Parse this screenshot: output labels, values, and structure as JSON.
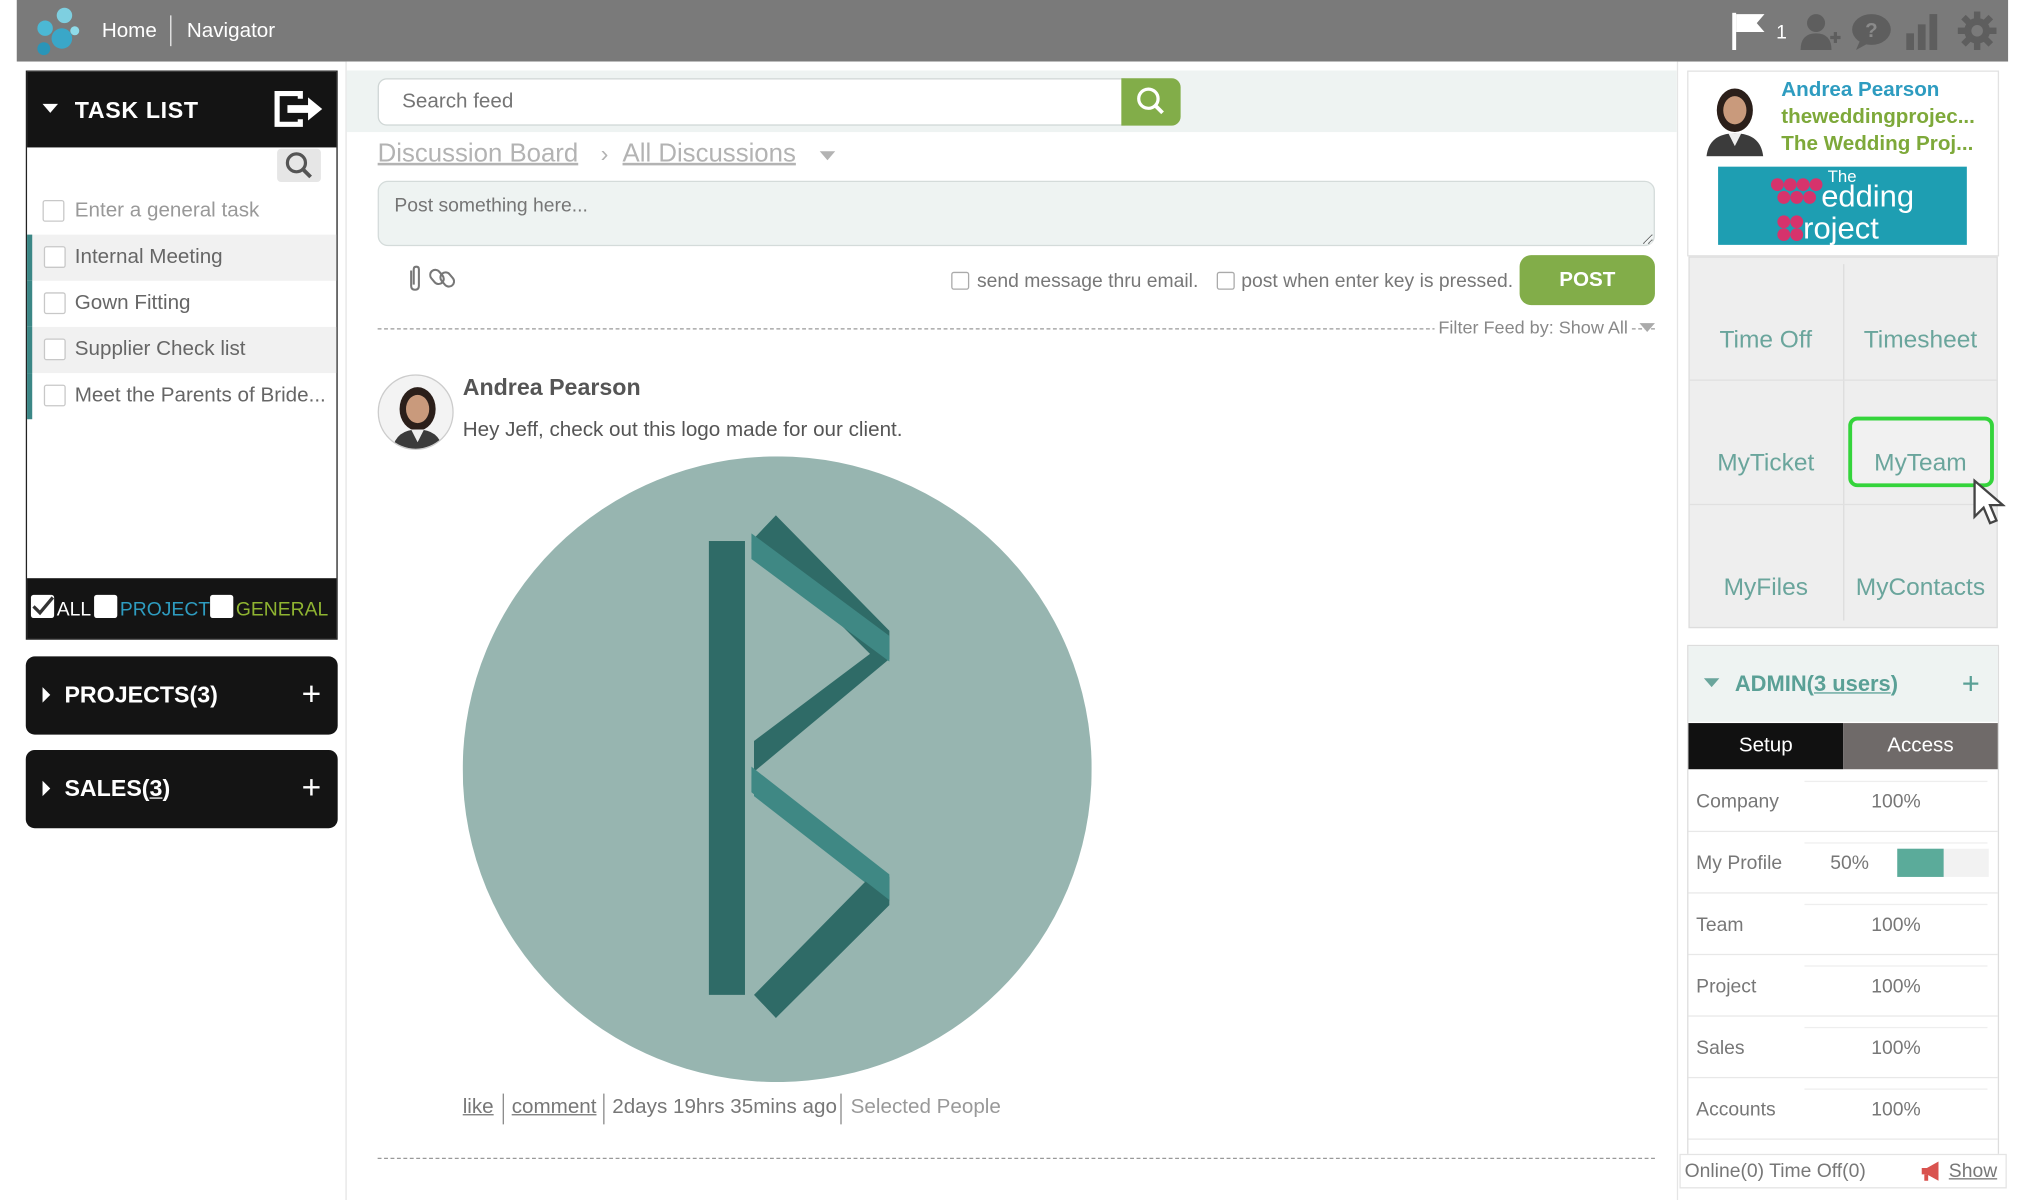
{
  "topbar": {
    "home_label": "Home",
    "navigator_label": "Navigator",
    "flag_count": "1",
    "icons": [
      "flag-icon",
      "add-user-icon",
      "help-icon",
      "chart-icon",
      "gear-icon"
    ]
  },
  "task_list": {
    "title": "TASK LIST",
    "input_placeholder": "Enter a general task",
    "tasks": [
      {
        "label": "Internal Meeting"
      },
      {
        "label": "Gown Fitting"
      },
      {
        "label": "Supplier Check list"
      },
      {
        "label": "Meet the Parents of Bride..."
      }
    ],
    "filters": [
      {
        "label": "ALL",
        "checked": true,
        "color": "#ffffff"
      },
      {
        "label": "PROJECT",
        "checked": false,
        "color": "#2e9cc0"
      },
      {
        "label": "GENERAL",
        "checked": false,
        "color": "#8fb431"
      }
    ]
  },
  "projects_panel": {
    "title": "PROJECTS(3)"
  },
  "sales_panel": {
    "title_prefix": "SALES(",
    "count": "3",
    "title_suffix": ")"
  },
  "feed": {
    "search_placeholder": "Search feed",
    "breadcrumb": {
      "board": "Discussion Board",
      "current": "All Discussions"
    },
    "post_placeholder": "Post something here...",
    "option_email": "send message thru email.",
    "option_enter": "post when enter key is pressed.",
    "post_button": "POST",
    "filter_label": "Filter Feed by: Show All",
    "post": {
      "author": "Andrea Pearson",
      "text": "Hey Jeff, check out this logo made for our client.",
      "like": "like",
      "comment": "comment",
      "time": "2days 19hrs 35mins ago",
      "audience": "Selected People"
    }
  },
  "profile": {
    "name": "Andrea Pearson",
    "company_short": "theweddingprojec...",
    "company_name": "The Wedding Proj...",
    "brand_small": "The",
    "brand_line1": "edding",
    "brand_line2": "roject"
  },
  "tiles": [
    {
      "label": "Time Off"
    },
    {
      "label": "Timesheet"
    },
    {
      "label": "MyTicket"
    },
    {
      "label": "MyTeam"
    },
    {
      "label": "MyFiles"
    },
    {
      "label": "MyContacts"
    }
  ],
  "admin": {
    "title_prefix": "ADMIN(",
    "users_link": "3 users",
    "title_suffix": ")",
    "tab_setup": "Setup",
    "tab_access": "Access",
    "rows": [
      {
        "label": "Company",
        "value": "100%"
      },
      {
        "label": "My Profile",
        "value": "50%",
        "progress": 0.5
      },
      {
        "label": "Team",
        "value": "100%"
      },
      {
        "label": "Project",
        "value": "100%"
      },
      {
        "label": "Sales",
        "value": "100%"
      },
      {
        "label": "Accounts",
        "value": "100%"
      }
    ]
  },
  "statusbar": {
    "text": "Online(0) Time Off(0)",
    "show": "Show"
  },
  "colors": {
    "topbar": "#7a7a7a",
    "accent_green": "#82ad49",
    "teal": "#5aa096",
    "highlight": "#34d43b"
  }
}
